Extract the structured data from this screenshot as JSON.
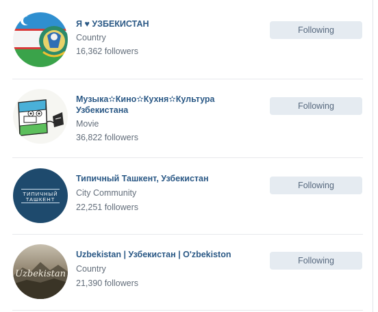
{
  "groups": [
    {
      "name": "Я ♥ УЗБЕКИСТАН",
      "category": "Country",
      "followers": "16,362 followers",
      "button": "Following",
      "avatar_icon": "uzbekistan-flag-avatar"
    },
    {
      "name": "Музыка✫Кино✫Кухня✫Культура Узбекистана",
      "category": "Movie",
      "followers": "36,822 followers",
      "button": "Following",
      "avatar_icon": "cartoon-flag-avatar"
    },
    {
      "name": "Типичный Ташкент, Узбекистан",
      "category": "City Community",
      "followers": "22,251 followers",
      "button": "Following",
      "avatar_icon": "typical-tashkent-logo-avatar",
      "avatar_text": [
        "ТИПИЧНЫЙ",
        "ТАШКЕНТ"
      ]
    },
    {
      "name": "Uzbekistan | Узбекистан | O'zbekiston",
      "category": "Country",
      "followers": "21,390 followers",
      "button": "Following",
      "avatar_icon": "uzbekistan-landscape-avatar",
      "avatar_text": "Uzbekistan"
    }
  ],
  "colors": {
    "name_link": "#2a5885",
    "meta_text": "#626d7a",
    "button_bg": "#e5ebf1",
    "button_text": "#55677d",
    "divider": "#e7e8ec"
  }
}
